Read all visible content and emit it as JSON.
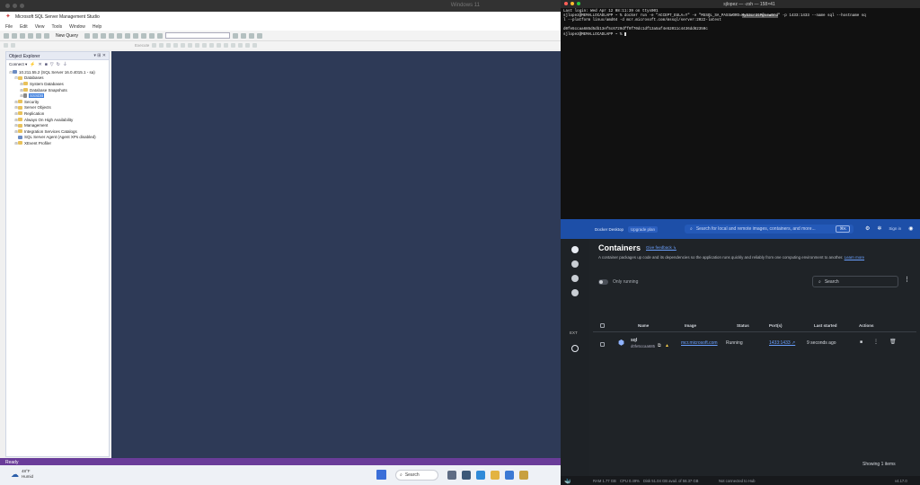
{
  "vm": {
    "title": "Windows 11",
    "ssms": {
      "title": "Microsoft SQL Server Management Studio",
      "menu": [
        "File",
        "Edit",
        "View",
        "Tools",
        "Window",
        "Help"
      ],
      "new_query_label": "New Query",
      "execute_label": "Execute",
      "object_explorer": {
        "title": "Object Explorer",
        "pin": "▾ ⊞ ✕",
        "connect_label": "Connect ▾",
        "tree": [
          {
            "label": "10.211.55.2 (SQL Server 16.0.4015.1 - sa)",
            "level": 0,
            "icon": "server",
            "expander": "⊟"
          },
          {
            "label": "Databases",
            "level": 1,
            "icon": "folder",
            "expander": "⊟"
          },
          {
            "label": "System Databases",
            "level": 2,
            "icon": "folder",
            "expander": "⊞"
          },
          {
            "label": "Database Snapshots",
            "level": 2,
            "icon": "folder",
            "expander": "⊞"
          },
          {
            "label": "SSSDB",
            "level": 2,
            "icon": "database",
            "expander": "⊞",
            "selected": true
          },
          {
            "label": "Security",
            "level": 1,
            "icon": "folder",
            "expander": "⊞"
          },
          {
            "label": "Server Objects",
            "level": 1,
            "icon": "folder",
            "expander": "⊞"
          },
          {
            "label": "Replication",
            "level": 1,
            "icon": "folder",
            "expander": "⊞"
          },
          {
            "label": "Always On High Availability",
            "level": 1,
            "icon": "folder",
            "expander": "⊞"
          },
          {
            "label": "Management",
            "level": 1,
            "icon": "folder",
            "expander": "⊞"
          },
          {
            "label": "Integration Services Catalogs",
            "level": 1,
            "icon": "folder",
            "expander": "⊞"
          },
          {
            "label": "SQL Server Agent (Agent XPs disabled)",
            "level": 1,
            "icon": "agent",
            "expander": ""
          },
          {
            "label": "XEvent Profiler",
            "level": 1,
            "icon": "folder",
            "expander": "⊞"
          }
        ]
      },
      "status": "Ready"
    },
    "taskbar": {
      "weather_temp": "48°F",
      "weather_desc": "Humid",
      "search_label": "Search"
    }
  },
  "terminal": {
    "title": "sjlopez — -zsh — 158×41",
    "lines": [
      {
        "text": "Last login: Wed Apr 12 08:11:39 on ttys001"
      },
      {
        "pre": "sjlopez@MEMALLOCADLAPP ~ % docker run -e \"ACCEPT_EULA=Y\" -e \"MSSQL_SA_PASSWORD=",
        "hl": "MyS3cr3tP@ssw0rd",
        "post": "\" -p 1433:1433 --name sql --hostname sq"
      },
      {
        "text": "l --platform linux/amd64 -d mcr.microsoft.com/mssql/server:2022-latest"
      },
      {
        "text": ""
      },
      {
        "text": "d0fe5ccaa685d5db13ef5c6720dff9f70dc1df13a5af4e52011c4436dd62350c"
      },
      {
        "pre": "sjlopez@MEMALLOCADLAPP ~ % ",
        "cursor": true
      }
    ]
  },
  "docker": {
    "brand": "Docker Desktop",
    "personal": "Upgrade plan",
    "search_placeholder": "Search for local and remote images, containers, and more...",
    "search_kbd": "⌘K",
    "signin": "Sign in",
    "extensions_label": "EXT",
    "heading": "Containers",
    "feedback": "Give feedback ↳",
    "description": "A container packages up code and its dependencies so the application runs quickly and reliably from one computing environment to another.",
    "learn_more": "Learn more",
    "only_running": "Only running",
    "filter_placeholder": "Search",
    "columns": [
      "Name",
      "Image",
      "Status",
      "Port(s)",
      "Last started",
      "Actions"
    ],
    "row": {
      "name": "sql",
      "id": "d0fe5ccaa685",
      "image": "mcr.microsoft.com",
      "status": "Running",
      "ports": "1433:1433 ↗",
      "last_started": "9 seconds ago"
    },
    "count": "Showing 1 items",
    "footer": {
      "ram": "RAM 1.77 GB",
      "cpu": "CPU 0.49%",
      "disk": "Disk 51.04 GB avail. of 58.37 GB",
      "hub": "Not connected to Hub",
      "version": "v4.17.0"
    }
  },
  "colors": {
    "ssms_canvas": "#2e3a57",
    "status_bar": "#6a3c99",
    "docker_blue": "#1d4fa8",
    "link": "#6aa0ff"
  }
}
